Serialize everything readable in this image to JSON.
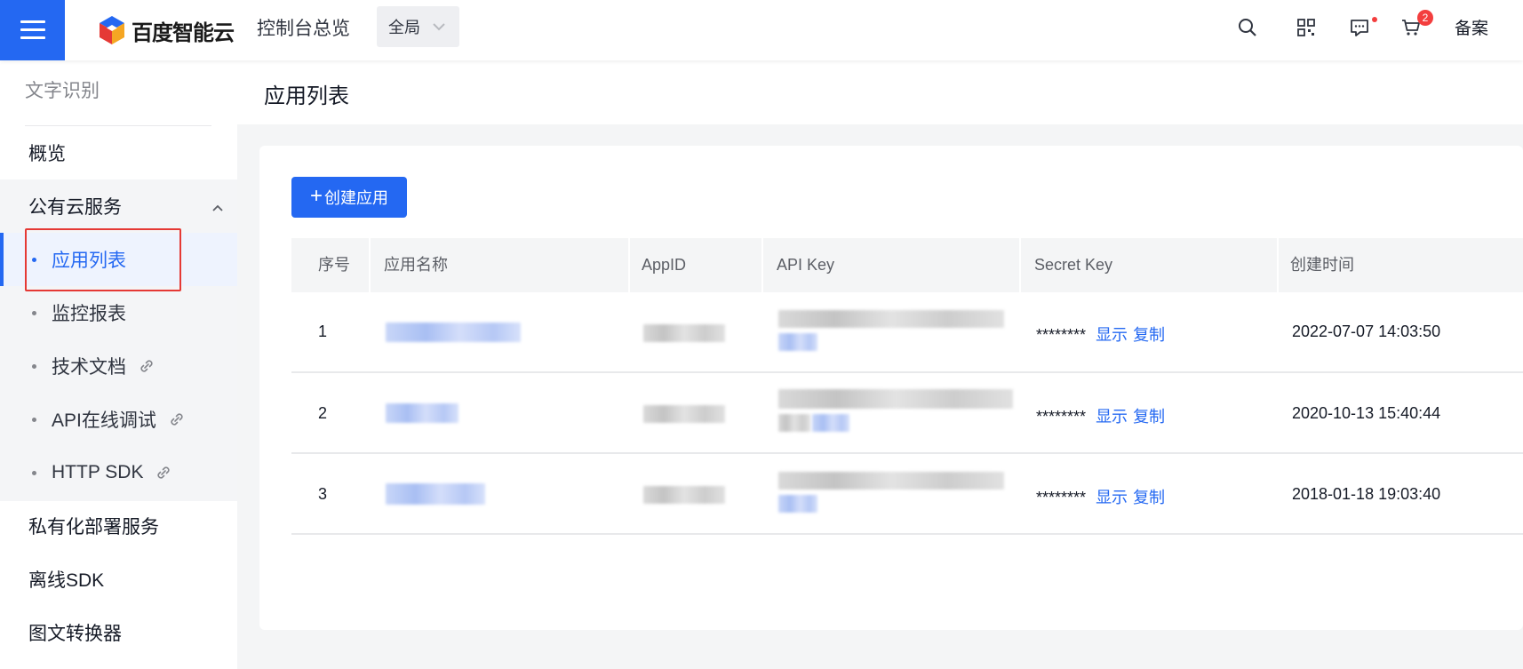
{
  "topbar": {
    "logo_text": "百度智能云",
    "console_label": "控制台总览",
    "region": "全局",
    "cart_badge": "2",
    "beian_label": "备案",
    "icons": [
      "search-icon",
      "qrcode-icon",
      "message-icon",
      "cart-icon"
    ]
  },
  "sidebar": {
    "title": "文字识别",
    "overview": "概览",
    "group_label": "公有云服务",
    "sub_items": [
      {
        "label": "应用列表",
        "active": true
      },
      {
        "label": "监控报表"
      },
      {
        "label": "技术文档",
        "external": true
      },
      {
        "label": "API在线调试",
        "external": true
      },
      {
        "label": "HTTP SDK",
        "external": true
      }
    ],
    "private_deploy": "私有化部署服务",
    "offline_sdk": "离线SDK",
    "converter": "图文转换器"
  },
  "page": {
    "title": "应用列表",
    "create_button": "创建应用"
  },
  "table": {
    "headers": [
      "序号",
      "应用名称",
      "AppID",
      "API Key",
      "Secret Key",
      "创建时间"
    ],
    "rows": [
      {
        "index": "1",
        "secret_mask": "********",
        "show": "显示",
        "copy": "复制",
        "created": "2022-07-07 14:03:50"
      },
      {
        "index": "2",
        "secret_mask": "********",
        "show": "显示",
        "copy": "复制",
        "created": "2020-10-13 15:40:44"
      },
      {
        "index": "3",
        "secret_mask": "********",
        "show": "显示",
        "copy": "复制",
        "created": "2018-01-18 19:03:40"
      }
    ]
  },
  "colors": {
    "accent": "#2468f2",
    "highlight_box": "#e53935",
    "badge": "#f33e3e"
  }
}
